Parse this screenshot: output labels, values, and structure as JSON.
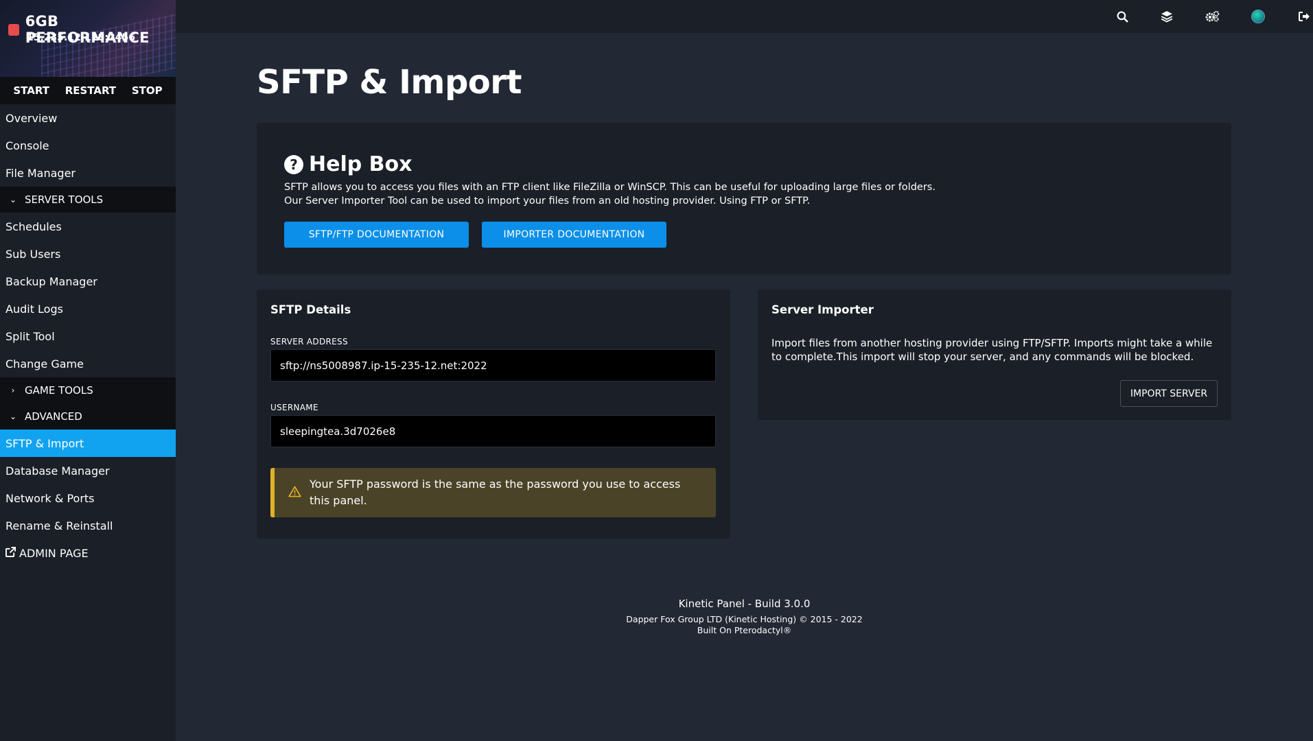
{
  "server": {
    "name": "6GB PERFORMANCE",
    "ip": "15.235.12.118:2456",
    "status_color": "#e74c4c"
  },
  "power": {
    "start": "START",
    "restart": "RESTART",
    "stop": "STOP"
  },
  "nav": {
    "overview": "Overview",
    "console": "Console",
    "file_manager": "File Manager",
    "server_tools": "SERVER TOOLS",
    "schedules": "Schedules",
    "sub_users": "Sub Users",
    "backup_manager": "Backup Manager",
    "audit_logs": "Audit Logs",
    "split_tool": "Split Tool",
    "change_game": "Change Game",
    "game_tools": "GAME TOOLS",
    "advanced": "ADVANCED",
    "sftp_import": "SFTP & Import",
    "database_manager": "Database Manager",
    "network_ports": "Network & Ports",
    "rename_reinstall": "Rename & Reinstall",
    "admin_page": "ADMIN PAGE"
  },
  "topbar_icons": [
    "search-icon",
    "layers-icon",
    "gears-icon",
    "avatar",
    "logout-icon"
  ],
  "page": {
    "title": "SFTP & Import"
  },
  "help_box": {
    "title": "Help Box",
    "line1": "SFTP allows you to access you files with an FTP client like FileZilla or WinSCP. This can be useful for uploading large files or folders.",
    "line2": "Our Server Importer Tool can be used to import your files from an old hosting provider. Using FTP or SFTP.",
    "btn_sftp_docs": "SFTP/FTP DOCUMENTATION",
    "btn_importer_docs": "IMPORTER DOCUMENTATION"
  },
  "sftp_details": {
    "title": "SFTP Details",
    "address_label": "SERVER ADDRESS",
    "address_value": "sftp://ns5008987.ip-15-235-12.net:2022",
    "username_label": "USERNAME",
    "username_value": "sleepingtea.3d7026e8",
    "warning": "Your SFTP password is the same as the password you use to access this panel."
  },
  "server_importer": {
    "title": "Server Importer",
    "text": "Import files from another hosting provider using FTP/SFTP. Imports might take a while to complete.This import will stop your server, and any commands will be blocked.",
    "button": "IMPORT SERVER"
  },
  "footer": {
    "line1": "Kinetic Panel - Build 3.0.0",
    "line2": "Dapper Fox Group LTD (Kinetic Hosting) © 2015 - 2022",
    "line3": "Built On Pterodactyl®"
  },
  "colors": {
    "accent": "#11a3f0",
    "button_blue": "#0b8fe8",
    "warning_border": "#e2b128",
    "warning_bg": "#4b4328"
  }
}
